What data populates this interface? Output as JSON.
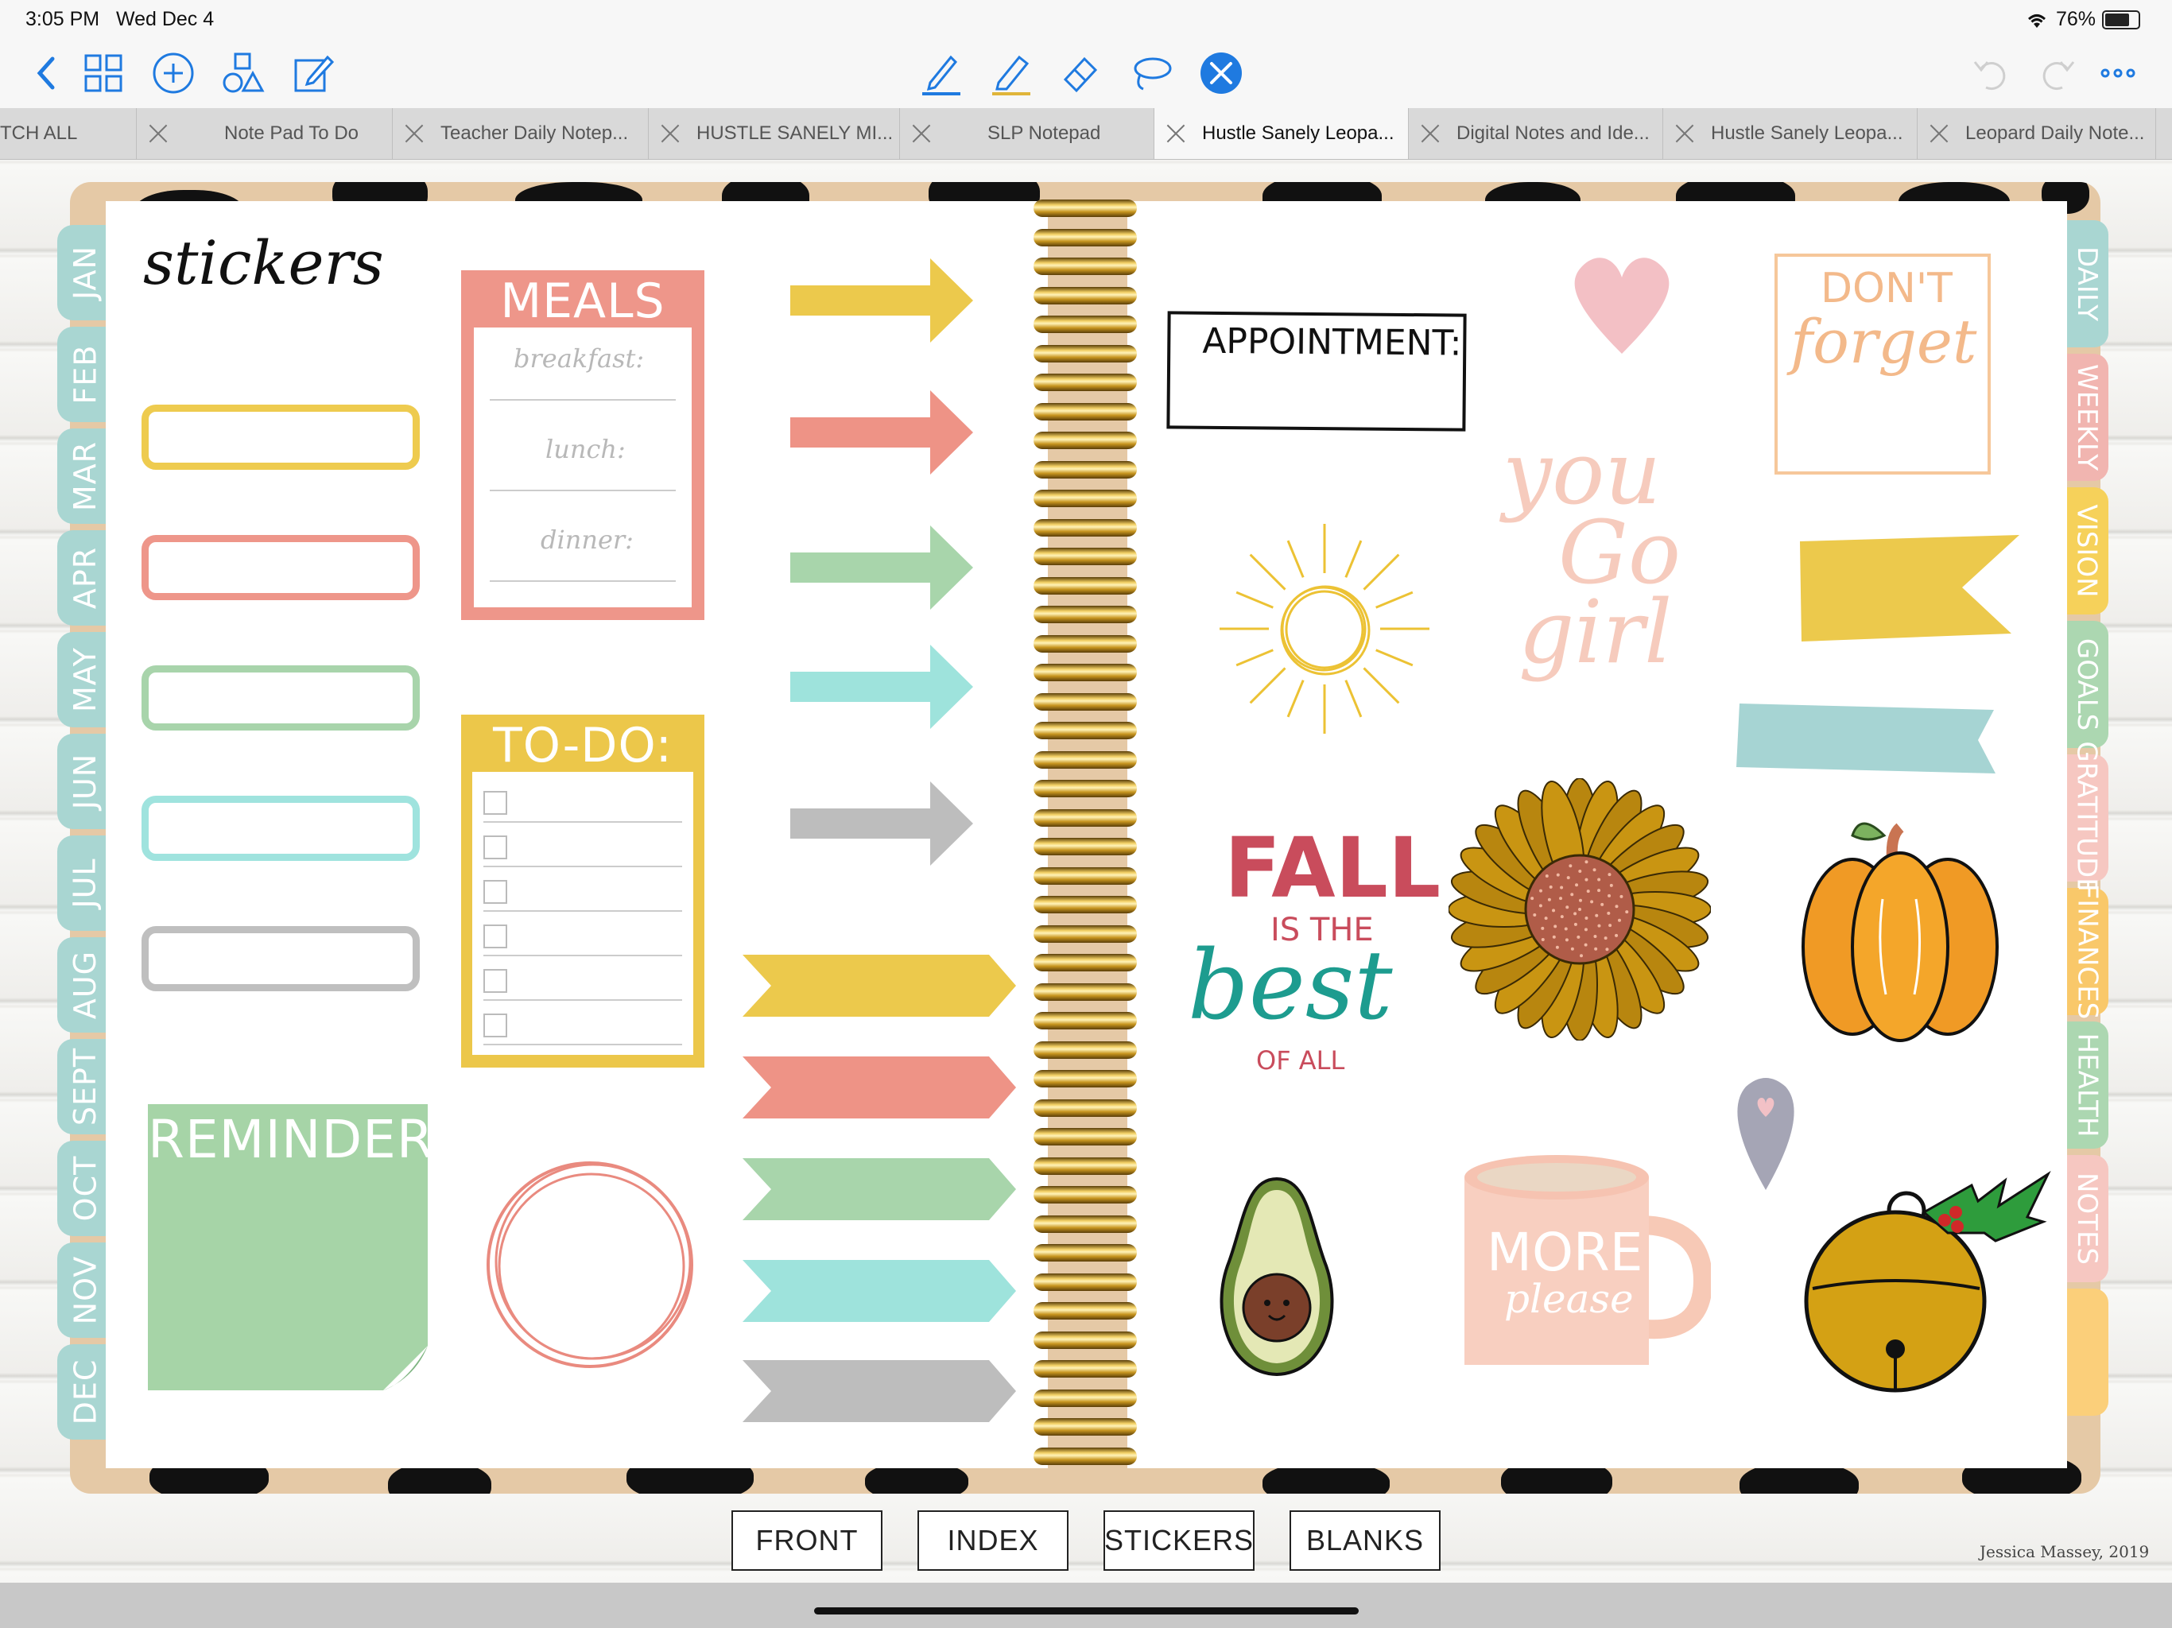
{
  "status_bar": {
    "time": "3:05 PM",
    "date": "Wed Dec 4",
    "battery": "76%",
    "battery_level": 0.76
  },
  "toolbar": {
    "left_icons": [
      "back-icon",
      "grid-icon",
      "add-icon",
      "shapes-icon",
      "edit-icon"
    ],
    "center_tools": [
      "pen-icon",
      "highlighter-icon",
      "eraser-icon",
      "lasso-icon",
      "bluetooth-pen-icon"
    ],
    "right_icons": [
      "undo-icon",
      "redo-icon",
      "more-icon"
    ],
    "accent": "#1f7ae0"
  },
  "tabs": [
    {
      "label": "TCH ALL",
      "closable": false
    },
    {
      "label": "Note Pad To Do",
      "closable": true
    },
    {
      "label": "Teacher Daily Notep...",
      "closable": true
    },
    {
      "label": "HUSTLE SANELY MI...",
      "closable": true
    },
    {
      "label": "SLP Notepad",
      "closable": true
    },
    {
      "label": "Hustle Sanely Leopa...",
      "closable": true,
      "active": true
    },
    {
      "label": "Digital Notes and Ide...",
      "closable": true
    },
    {
      "label": "Hustle Sanely Leopa...",
      "closable": true
    },
    {
      "label": "Leopard Daily Note...",
      "closable": true
    }
  ],
  "month_tabs": [
    "JAN",
    "FEB",
    "MAR",
    "APR",
    "MAY",
    "JUN",
    "JUL",
    "AUG",
    "SEPT",
    "OCT",
    "NOV",
    "DEC"
  ],
  "section_tabs": [
    {
      "label": "DAILY",
      "color": "#a9d6d2"
    },
    {
      "label": "WEEKLY",
      "color": "#f1b5b0"
    },
    {
      "label": "VISION",
      "color": "#f6d15a"
    },
    {
      "label": "GOALS",
      "color": "#acd7b1"
    },
    {
      "label": "GRATITUDE",
      "color": "#f6c7c1"
    },
    {
      "label": "FINANCES",
      "color": "#f9c86a"
    },
    {
      "label": "HEALTH",
      "color": "#acd7b1"
    },
    {
      "label": "NOTES",
      "color": "#f6c7c1"
    },
    {
      "label": "",
      "color": "#fbcf7a"
    }
  ],
  "left_page": {
    "title": "stickers",
    "label_colors": [
      "#eecb4f",
      "#ee968a",
      "#a8d4ab",
      "#9fe3de",
      "#bfbfbf"
    ],
    "meals": {
      "title": "MEALS",
      "lines": [
        "breakfast:",
        "lunch:",
        "dinner:"
      ],
      "color": "#ee968a"
    },
    "todo": {
      "title": "TO-DO:",
      "color": "#ecc74a",
      "checkbox_count": 6
    },
    "reminder": {
      "title": "REMINDER:",
      "color": "#a6d4a7"
    },
    "arrow_colors": [
      "#ecc94c",
      "#ee9386",
      "#a8d5ab",
      "#9ee3dc",
      "#bdbdbd"
    ],
    "banner_colors": [
      "#ecc94c",
      "#ee9386",
      "#a8d5ab",
      "#9ee3dc",
      "#bdbdbd"
    ]
  },
  "right_page": {
    "appointment": "APPOINTMENT:",
    "dont_forget": [
      "DON'T",
      "forget"
    ],
    "you_go_girl": [
      "you",
      "Go",
      "girl"
    ],
    "fall": [
      "FALL",
      "IS THE",
      "best",
      "OF ALL"
    ],
    "mug": [
      "MORE",
      "please"
    ]
  },
  "bottom_nav": [
    "FRONT",
    "INDEX",
    "STICKERS",
    "BLANKS"
  ],
  "credit": "Jessica Massey, 2019"
}
